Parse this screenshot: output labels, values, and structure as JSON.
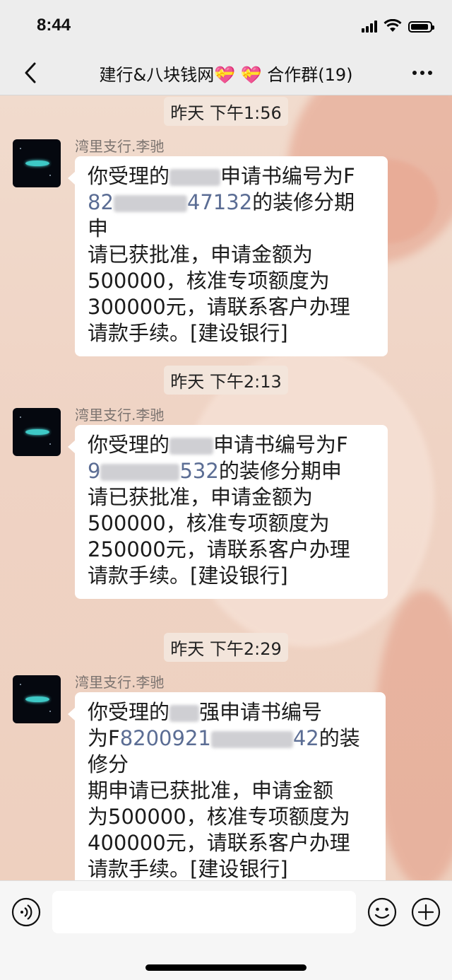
{
  "status_bar": {
    "time": "8:44"
  },
  "nav": {
    "title": "建行&八块钱网💝 💝 合作群(19)"
  },
  "chat": {
    "messages": [
      {
        "timestamp": "昨天 下午1:56",
        "sender": "湾里支行.李驰",
        "lines": [
          {
            "parts": [
              "你受理的",
              "@blur",
              "申请书编号为F"
            ]
          },
          {
            "parts": [
              "@link:82",
              "@blur",
              "@link:47132",
              "的装修分期申"
            ]
          },
          {
            "parts": [
              "请已获批准，申请金额为"
            ]
          },
          {
            "parts": [
              "500000，核准专项额度为"
            ]
          },
          {
            "parts": [
              "300000元，请联系客户办理"
            ]
          },
          {
            "parts": [
              "请款手续。[建设银行]"
            ]
          }
        ]
      },
      {
        "timestamp": "昨天 下午2:13",
        "sender": "湾里支行.李驰",
        "lines": [
          {
            "parts": [
              "你受理的",
              "@blur",
              "申请书编号为F"
            ]
          },
          {
            "parts": [
              "@link:9",
              "@blur",
              "@link:532",
              "的装修分期申"
            ]
          },
          {
            "parts": [
              "请已获批准，申请金额为"
            ]
          },
          {
            "parts": [
              "500000，核准专项额度为"
            ]
          },
          {
            "parts": [
              "250000元，请联系客户办理"
            ]
          },
          {
            "parts": [
              "请款手续。[建设银行]"
            ]
          }
        ]
      },
      {
        "timestamp": "昨天 下午2:29",
        "sender": "湾里支行.李驰",
        "lines": [
          {
            "parts": [
              "你受理的",
              "@blur",
              "强申请书编号"
            ]
          },
          {
            "parts": [
              "为F",
              "@link:8200921",
              "@blur",
              "@link:42",
              "的装修分"
            ]
          },
          {
            "parts": [
              "期申请已获批准，申请金额"
            ]
          },
          {
            "parts": [
              "为500000，核准专项额度为"
            ]
          },
          {
            "parts": [
              "400000元，请联系客户办理"
            ]
          },
          {
            "parts": [
              "请款手续。[建设银行]"
            ]
          }
        ]
      }
    ]
  },
  "input": {
    "placeholder": ""
  },
  "icons": {
    "back": "chevron-left-icon",
    "more": "more-dots-icon",
    "voice": "voice-icon",
    "emoji": "emoji-icon",
    "plus": "plus-icon"
  },
  "colors": {
    "bar_bg": "#ededed",
    "bubble_bg": "#ffffff",
    "link": "#5b6d94"
  }
}
